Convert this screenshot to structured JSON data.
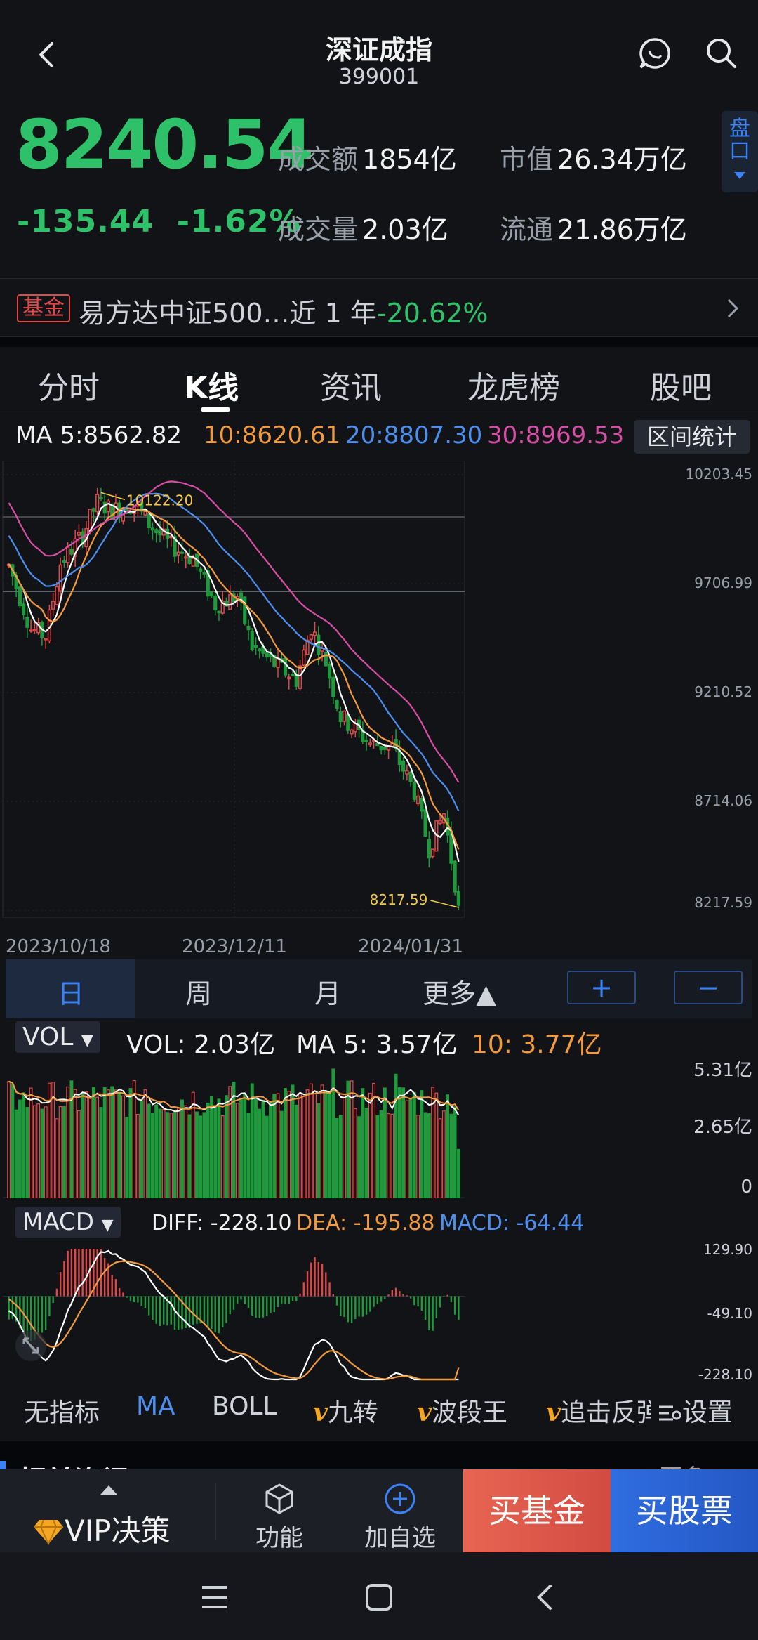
{
  "header": {
    "title": "深证成指",
    "code": "399001"
  },
  "quote": {
    "price": "8240.54",
    "change": "-135.44",
    "change_pct": "-1.62%",
    "turnover_label": "成交额",
    "turnover_value": "1854亿",
    "volume_label": "成交量",
    "volume_value": "2.03亿",
    "market_cap_label": "市值",
    "market_cap_value": "26.34万亿",
    "float_label": "流通",
    "float_value": "21.86万亿",
    "pankou_label": "盘口"
  },
  "fund_banner": {
    "tag": "基金",
    "text": "易方达中证500…近 1 年",
    "return": "-20.62%"
  },
  "tabs": [
    "分时",
    "K线",
    "资讯",
    "龙虎榜",
    "股吧"
  ],
  "ma_legend": {
    "ma5": "MA 5:8562.82",
    "ma10": "10:8620.61",
    "ma20": "20:8807.30",
    "ma30": "30:8969.53",
    "range_button": "区间统计"
  },
  "kline_axis": {
    "y_ticks": [
      "10203.45",
      "9706.99",
      "9210.52",
      "8714.06",
      "8217.59"
    ],
    "x_ticks": [
      "2023/10/18",
      "2023/12/11",
      "2024/01/31"
    ],
    "high_label": "10122.20",
    "low_label": "8217.59"
  },
  "period_bar": {
    "day": "日",
    "week": "周",
    "month": "月",
    "more": "更多▲",
    "zoom_in": "+",
    "zoom_out": "−"
  },
  "volume": {
    "selector": "VOL",
    "vol": "VOL: 2.03亿",
    "ma5": "MA 5: 3.57亿",
    "ma10": "10: 3.77亿",
    "y_ticks": [
      "5.31亿",
      "2.65亿",
      "0"
    ]
  },
  "macd": {
    "selector": "MACD",
    "diff": "DIFF: -228.10",
    "dea": "DEA: -195.88",
    "macd": "MACD: -64.44",
    "y_ticks": [
      "129.90",
      "-49.10",
      "-228.10"
    ]
  },
  "indicators": {
    "none": "无指标",
    "ma": "MA",
    "boll": "BOLL",
    "v_mark": "v",
    "jiuzhuan": "九转",
    "boduan": "波段王",
    "zhuiji": "追击反弹",
    "settings": "设置"
  },
  "section_peek": {
    "title": "相关资讯",
    "more": "更多"
  },
  "bottom_bar": {
    "vip": "VIP决策",
    "function": "功能",
    "watchlist": "加自选",
    "buy_fund": "买基金",
    "buy_stock": "买股票"
  },
  "colors": {
    "up": "#e04848",
    "down": "#1f9a3d",
    "price_down": "#2fc06a",
    "ma5": "#ffffff",
    "ma10": "#f39a3c",
    "ma20": "#4c8ff0",
    "ma30": "#d84ea6"
  },
  "chart_data": {
    "type": "candlestick",
    "x_range": [
      "2023/10/18",
      "2024/01/31"
    ],
    "ylim": [
      8217.59,
      10203.45
    ],
    "high": 10122.2,
    "low": 8217.59,
    "close": 8240.54,
    "ma": {
      "MA5": 8562.82,
      "MA10": 8620.61,
      "MA20": 8807.3,
      "MA30": 8969.53
    },
    "volume_ylim": [
      0,
      5.31
    ],
    "volume_last": 2.03,
    "volume_ma5": 3.57,
    "volume_ma10": 3.77,
    "macd_ylim": [
      -228.1,
      129.9
    ],
    "diff": -228.1,
    "dea": -195.88,
    "macd": -64.44
  }
}
